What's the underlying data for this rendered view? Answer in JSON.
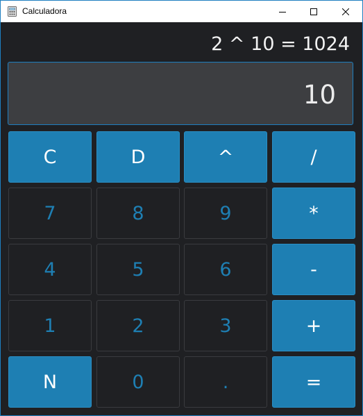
{
  "window": {
    "title": "Calculadora",
    "app_icon": "calculator-icon",
    "controls": {
      "minimize": "minimize-icon",
      "maximize": "maximize-icon",
      "close": "close-icon"
    }
  },
  "calculator": {
    "expression": "2 ^ 10 = 1024",
    "display_value": "10",
    "keys": [
      [
        "C",
        "D",
        "^",
        "/"
      ],
      [
        "7",
        "8",
        "9",
        "*"
      ],
      [
        "4",
        "5",
        "6",
        "-"
      ],
      [
        "1",
        "2",
        "3",
        "+"
      ],
      [
        "N",
        "0",
        ".",
        "="
      ]
    ]
  },
  "colors": {
    "accent": "#1e7fb3",
    "background": "#1f2023",
    "display_background": "#3d3e41",
    "display_border": "#1e7fc0"
  }
}
